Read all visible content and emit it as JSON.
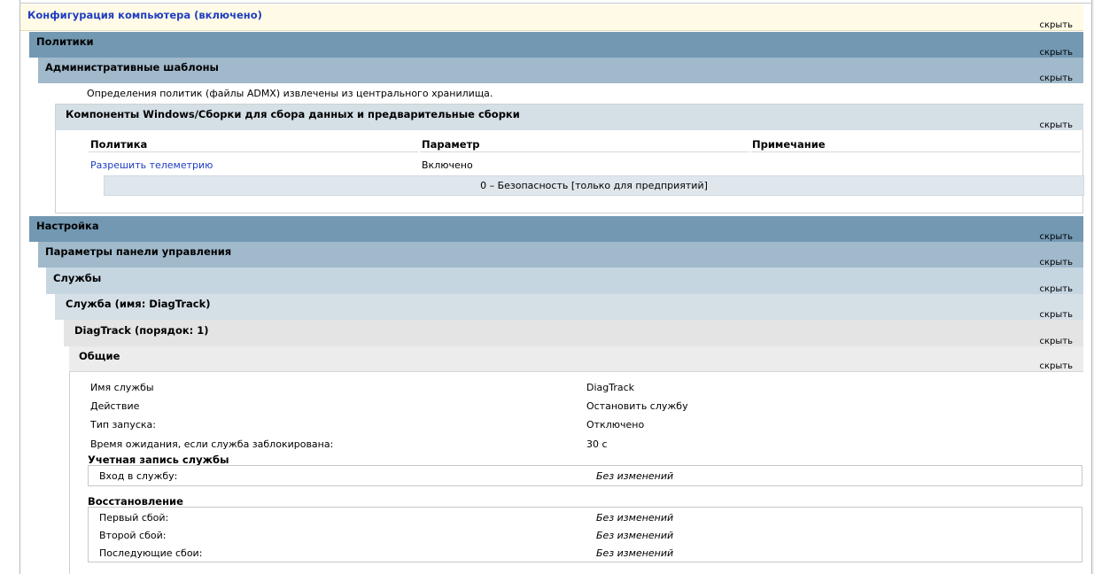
{
  "hide_label": "скрыть",
  "computer_config": {
    "title": "Конфигурация компьютера (включено)"
  },
  "policies": {
    "title": "Политики",
    "admin_templates": {
      "title": "Административные шаблоны",
      "note": "Определения политик (файлы ADMX) извлечены из центрального хранилища.",
      "components": {
        "title": "Компоненты Windows/Сборки для сбора данных и предварительные сборки",
        "columns": [
          "Политика",
          "Параметр",
          "Примечание"
        ],
        "row": {
          "policy": "Разрешить телеметрию",
          "setting": "Включено",
          "detail": "0 – Безопасность [только для предприятий]"
        }
      }
    }
  },
  "preferences": {
    "title": "Настройка",
    "control_panel": {
      "title": "Параметры панели управления"
    },
    "services": {
      "title": "Службы"
    },
    "service": {
      "title": "Служба (имя: DiagTrack)"
    },
    "diagtrack": {
      "title": "DiagTrack (порядок: 1)"
    },
    "general": {
      "title": "Общие",
      "rows": [
        {
          "label": "Имя службы",
          "value": "DiagTrack"
        },
        {
          "label": "Действие",
          "value": "Остановить службу"
        },
        {
          "label": "Тип запуска:",
          "value": "Отключено"
        },
        {
          "label": "Время ожидания, если служба заблокирована:",
          "value": "30 с"
        }
      ],
      "account": {
        "title": "Учетная запись службы",
        "rows": [
          {
            "label": "Вход в службу:",
            "value": "Без изменений"
          }
        ]
      },
      "recovery": {
        "title": "Восстановление",
        "rows": [
          {
            "label": "Первый сбой:",
            "value": "Без изменений"
          },
          {
            "label": "Второй сбой:",
            "value": "Без изменений"
          },
          {
            "label": "Последующие сбои:",
            "value": "Без изменений"
          }
        ]
      }
    }
  }
}
